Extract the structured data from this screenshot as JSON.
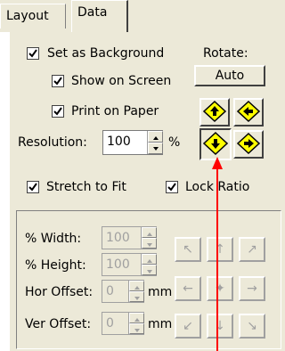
{
  "tabs": [
    {
      "label": "Layout"
    },
    {
      "label": "Data"
    }
  ],
  "set_as_background": {
    "label": "Set as Background",
    "checked": true
  },
  "show_on_screen": {
    "label": "Show on Screen",
    "checked": true
  },
  "print_on_paper": {
    "label": "Print on Paper",
    "checked": true
  },
  "rotate": {
    "label": "Rotate:",
    "auto_label": "Auto"
  },
  "resolution": {
    "label": "Resolution:",
    "value": "100",
    "unit": "%"
  },
  "stretch_to_fit": {
    "label": "Stretch to Fit",
    "checked": true
  },
  "lock_ratio": {
    "label": "Lock Ratio",
    "checked": true
  },
  "width": {
    "label": "% Width:",
    "value": "100"
  },
  "height": {
    "label": "% Height:",
    "value": "100"
  },
  "hor_offset": {
    "label": "Hor Offset:",
    "value": "0",
    "unit": "mm"
  },
  "ver_offset": {
    "label": "Ver Offset:",
    "value": "0",
    "unit": "mm"
  },
  "colors": {
    "accent": "#ffff00",
    "arrow": "#ff0000",
    "panel": "#ece9d8"
  }
}
